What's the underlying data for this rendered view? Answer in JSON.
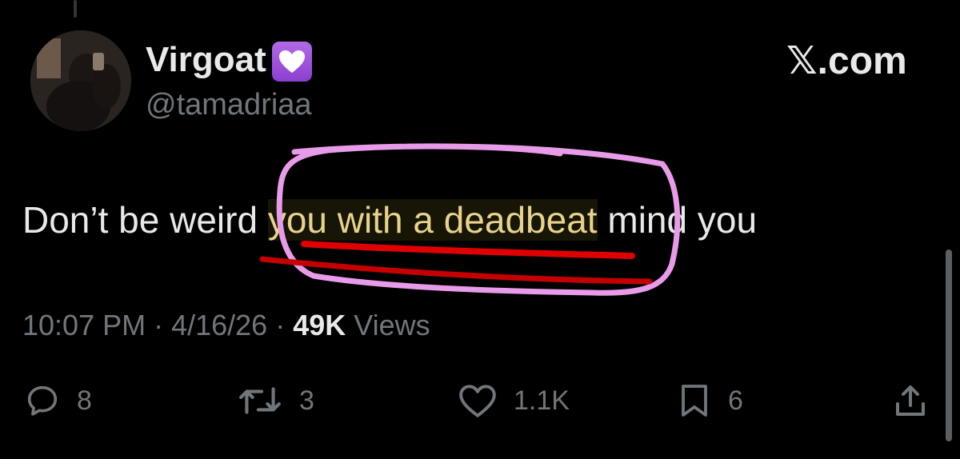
{
  "author": {
    "display_name": "Virgoat",
    "handle": "@tamadriaa",
    "badge_icon": "purple-heart-icon"
  },
  "brand": {
    "logo_text": "𝕏.com"
  },
  "tweet": {
    "text_before": "Don’t be weird ",
    "text_highlight": "you with a deadbeat",
    "text_after": " mind you"
  },
  "meta": {
    "time": "10:07 PM",
    "separator": " · ",
    "date": "4/16/26",
    "view_count": "49K",
    "views_label": " Views"
  },
  "actions": {
    "replies": "8",
    "reposts": "3",
    "likes": "1.1K",
    "bookmarks": "6"
  },
  "colors": {
    "background": "#000000",
    "primary_text": "#e7e9ea",
    "secondary_text": "#71767b",
    "highlight_text": "#e8d38c",
    "circle_annotation": "#e89be8",
    "underline_annotation": "#e00000"
  }
}
